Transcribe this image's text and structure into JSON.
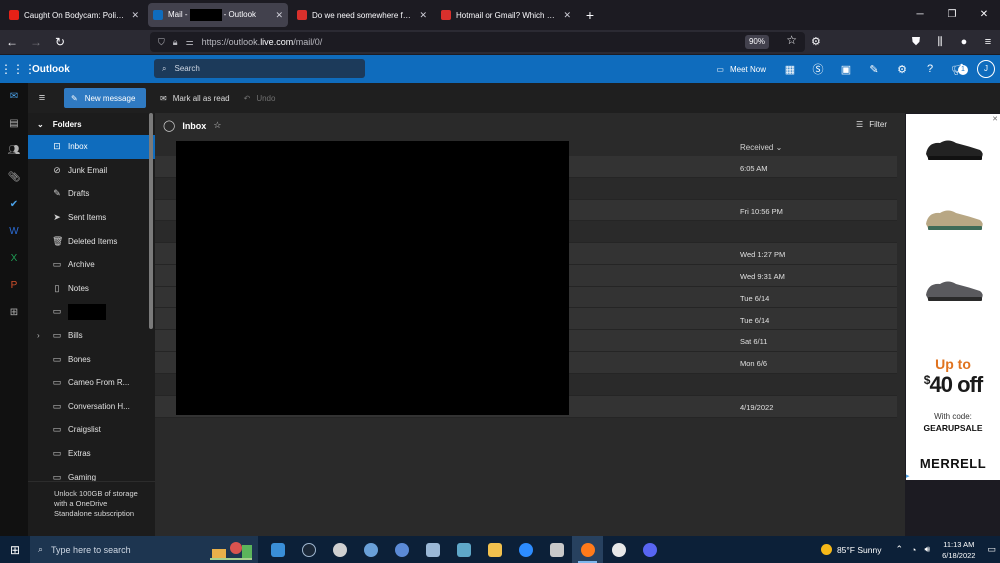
{
  "browser": {
    "tabs": [
      {
        "title": "Caught On Bodycam: Police De",
        "favicon_color": "#e62117",
        "active": false
      },
      {
        "title_prefix": "Mail -",
        "title_suffix": "- Outlook",
        "favicon_color": "#0f6cbd",
        "active": true
      },
      {
        "title": "Do we need somewhere for pe",
        "favicon_color": "#d9302c",
        "active": false
      },
      {
        "title": "Hotmail or Gmail? Which one o",
        "favicon_color": "#d9302c",
        "active": false
      }
    ],
    "close_glyph": "✕",
    "new_tab_glyph": "+",
    "url_host_prefix": "https://outlook.",
    "url_host_domain": "live.com",
    "url_path": "/mail/0/",
    "zoom": "90%"
  },
  "outlook": {
    "app_name": "Outlook",
    "search_placeholder": "Search",
    "meet_now": "Meet Now",
    "notification_count": "1",
    "avatar_initial": "J"
  },
  "commands": {
    "new_message": "New message",
    "mark_all_read": "Mark all as read",
    "undo": "Undo"
  },
  "folders": {
    "header": "Folders",
    "items": [
      {
        "label": "Inbox",
        "icon": "inbox-icon",
        "selected": true
      },
      {
        "label": "Junk Email",
        "icon": "junk-icon"
      },
      {
        "label": "Drafts",
        "icon": "pencil-icon"
      },
      {
        "label": "Sent Items",
        "icon": "send-icon"
      },
      {
        "label": "Deleted Items",
        "icon": "trash-icon"
      },
      {
        "label": "Archive",
        "icon": "archive-icon"
      },
      {
        "label": "Notes",
        "icon": "note-icon"
      },
      {
        "label": "",
        "icon": "folder-icon",
        "redacted": true
      },
      {
        "label": "Bills",
        "icon": "folder-icon",
        "expandable": true
      },
      {
        "label": "Bones",
        "icon": "folder-icon"
      },
      {
        "label": "Cameo From R...",
        "icon": "folder-icon"
      },
      {
        "label": "Conversation H...",
        "icon": "folder-icon"
      },
      {
        "label": "Craigslist",
        "icon": "folder-icon"
      },
      {
        "label": "Extras",
        "icon": "folder-icon"
      },
      {
        "label": "Gaming",
        "icon": "folder-icon"
      }
    ],
    "upsell": "Unlock 100GB of storage with a OneDrive Standalone subscription"
  },
  "message_list": {
    "title": "Inbox",
    "filter": "Filter",
    "sort_column": "Received",
    "rows": [
      {
        "date": "6:05 AM",
        "style": "tall"
      },
      {
        "date": "",
        "style": "sep"
      },
      {
        "date": "Fri 10:56 PM",
        "style": "row"
      },
      {
        "date": "",
        "style": "sep"
      },
      {
        "date": "Wed 1:27 PM",
        "style": "row"
      },
      {
        "date": "Wed 9:31 AM",
        "style": "row"
      },
      {
        "date": "Tue 6/14",
        "style": "row"
      },
      {
        "date": "Tue 6/14",
        "style": "row"
      },
      {
        "date": "Sat 6/11",
        "style": "row"
      },
      {
        "date": "Mon 6/6",
        "style": "row"
      },
      {
        "date": "",
        "style": "sep"
      },
      {
        "date": "4/19/2022",
        "style": "row"
      }
    ]
  },
  "ad": {
    "headline": "Up to",
    "currency": "$",
    "amount": "40",
    "suffix": "off",
    "code_label": "With code:",
    "code": "GEARUPSALE",
    "brand": "MERRELL"
  },
  "taskbar": {
    "search_placeholder": "Type here to search",
    "weather": "85°F  Sunny",
    "time": "11:13 AM",
    "date": "6/18/2022",
    "apps": [
      {
        "name": "photos-app-icon",
        "color": "#3a8fd8"
      },
      {
        "name": "steam-icon",
        "color": "#1b2838"
      },
      {
        "name": "obs-icon",
        "color": "#d0d0d0"
      },
      {
        "name": "bird-app-icon",
        "color": "#6aa0d8"
      },
      {
        "name": "bird-app-2-icon",
        "color": "#5b8ad6"
      },
      {
        "name": "news-app-icon",
        "color": "#9bb8d6"
      },
      {
        "name": "notepad-icon",
        "color": "#5fa8c9"
      },
      {
        "name": "file-explorer-icon",
        "color": "#f2c14e"
      },
      {
        "name": "zoom-icon",
        "color": "#2d8cff"
      },
      {
        "name": "media-app-icon",
        "color": "#c9c9c9"
      },
      {
        "name": "firefox-icon",
        "color": "#ff7a1a",
        "active": true
      },
      {
        "name": "slack-icon",
        "color": "#e8e8e8"
      },
      {
        "name": "discord-icon",
        "color": "#5865f2"
      }
    ]
  }
}
